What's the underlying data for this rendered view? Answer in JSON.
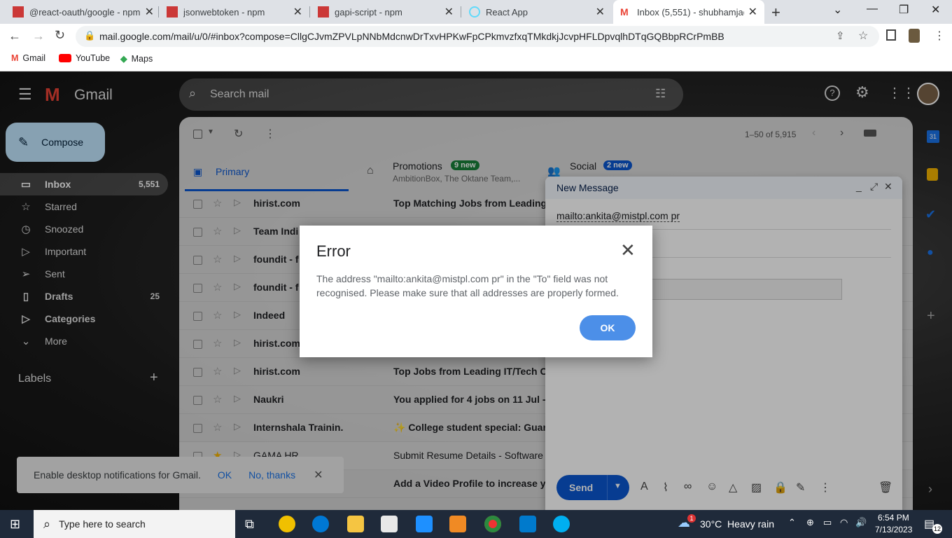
{
  "browser": {
    "tabs": [
      {
        "title": "@react-oauth/google - npm",
        "close": "✕"
      },
      {
        "title": "jsonwebtoken - npm",
        "close": "✕"
      },
      {
        "title": "gapi-script - npm",
        "close": "✕"
      },
      {
        "title": "React App",
        "close": "✕"
      },
      {
        "title": "Inbox (5,551) - shubhamjado",
        "close": "✕"
      }
    ],
    "new_tab": "+",
    "url": "mail.google.com/mail/u/0/#inbox?compose=CllgCJvmZPVLpNNbMdcnwDrTxvHPKwFpCPkmvzfxqTMkdkjJcvpHFLDpvqlhDTqGQBbpRCrPmBB",
    "bookmarks": [
      "Gmail",
      "YouTube",
      "Maps"
    ]
  },
  "gmail": {
    "logo_text": "Gmail",
    "search_placeholder": "Search mail",
    "compose_label": "Compose",
    "nav": [
      {
        "label": "Inbox",
        "count": "5,551",
        "icon": "▭"
      },
      {
        "label": "Starred",
        "count": "",
        "icon": "☆"
      },
      {
        "label": "Snoozed",
        "count": "",
        "icon": "◷"
      },
      {
        "label": "Important",
        "count": "",
        "icon": "▷"
      },
      {
        "label": "Sent",
        "count": "",
        "icon": "➢"
      },
      {
        "label": "Drafts",
        "count": "25",
        "icon": "▯"
      },
      {
        "label": "Categories",
        "count": "",
        "icon": "▷"
      },
      {
        "label": "More",
        "count": "",
        "icon": "⌄"
      }
    ],
    "labels_heading": "Labels",
    "labels_add": "+",
    "pagination": "1–50 of 5,915",
    "tabs": [
      {
        "label": "Primary"
      },
      {
        "label": "Promotions",
        "badge": "9 new",
        "snippet": "AmbitionBox, The Oktane Team,..."
      },
      {
        "label": "Social",
        "badge": "2 new"
      }
    ],
    "emails": [
      {
        "sender": "hirist.com",
        "subject": "Top Matching Jobs from Leading"
      },
      {
        "sender": "Team Indi",
        "subject": ""
      },
      {
        "sender": "foundit - f",
        "subject": ""
      },
      {
        "sender": "foundit - f",
        "subject": ""
      },
      {
        "sender": "Indeed",
        "subject": ""
      },
      {
        "sender": "hirist.com",
        "subject": ""
      },
      {
        "sender": "hirist.com",
        "subject": "Top Jobs from Leading IT/Tech C"
      },
      {
        "sender": "Naukri",
        "subject": "You applied for 4 jobs on 11 Jul -"
      },
      {
        "sender": "Internshala Trainin.",
        "subject": "✨ College student special: Guar"
      },
      {
        "sender": "GAMA HR",
        "subject": "Submit Resume Details - Software"
      },
      {
        "sender": "",
        "subject": "Add a Video Profile to increase y"
      }
    ],
    "compose_window": {
      "title": "New Message",
      "to_value": "mailto:ankita@mistpl.com pr",
      "send_label": "Send"
    },
    "notification": {
      "text": "Enable desktop notifications for Gmail.",
      "ok": "OK",
      "no": "No, thanks"
    }
  },
  "dialog": {
    "title": "Error",
    "message": "The address \"mailto:ankita@mistpl.com pr\" in the \"To\" field was not recognised. Please make sure that all addresses are properly formed.",
    "ok_label": "OK",
    "close": "✕"
  },
  "taskbar": {
    "search_placeholder": "Type here to search",
    "weather": "30°C  Heavy rain",
    "weather_badge": "1",
    "time": "6:54 PM",
    "date": "7/13/2023",
    "notification_count": "12"
  },
  "colors": {
    "accent": "#0b57d0",
    "ok_button": "#4c8fe8",
    "compose_bg": "#c2e7ff"
  }
}
